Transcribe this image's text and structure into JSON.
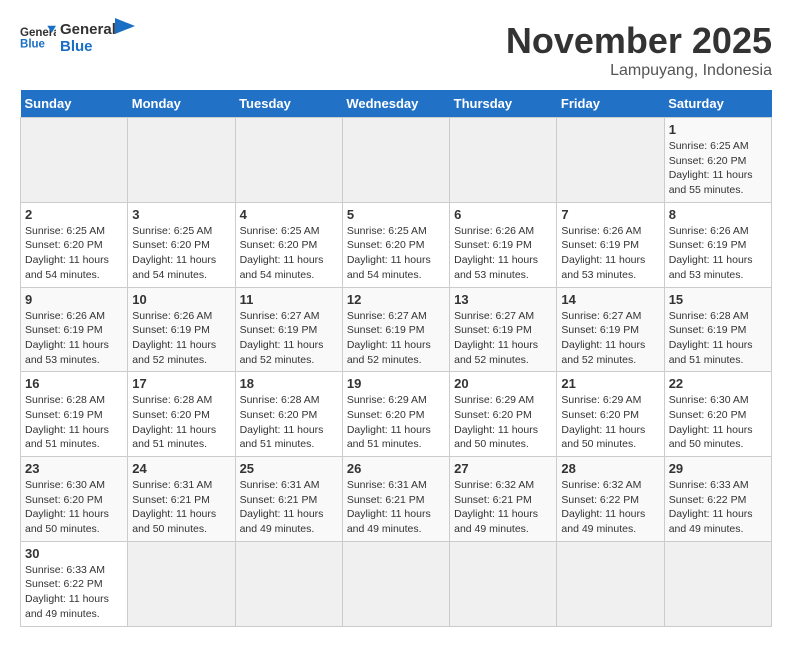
{
  "header": {
    "logo_general": "General",
    "logo_blue": "Blue",
    "month_title": "November 2025",
    "subtitle": "Lampuyang, Indonesia"
  },
  "days_of_week": [
    "Sunday",
    "Monday",
    "Tuesday",
    "Wednesday",
    "Thursday",
    "Friday",
    "Saturday"
  ],
  "weeks": [
    [
      {
        "day": "",
        "details": ""
      },
      {
        "day": "",
        "details": ""
      },
      {
        "day": "",
        "details": ""
      },
      {
        "day": "",
        "details": ""
      },
      {
        "day": "",
        "details": ""
      },
      {
        "day": "",
        "details": ""
      },
      {
        "day": "1",
        "details": "Sunrise: 6:25 AM\nSunset: 6:20 PM\nDaylight: 11 hours and 55 minutes."
      }
    ],
    [
      {
        "day": "2",
        "details": "Sunrise: 6:25 AM\nSunset: 6:20 PM\nDaylight: 11 hours and 54 minutes."
      },
      {
        "day": "3",
        "details": "Sunrise: 6:25 AM\nSunset: 6:20 PM\nDaylight: 11 hours and 54 minutes."
      },
      {
        "day": "4",
        "details": "Sunrise: 6:25 AM\nSunset: 6:20 PM\nDaylight: 11 hours and 54 minutes."
      },
      {
        "day": "5",
        "details": "Sunrise: 6:25 AM\nSunset: 6:20 PM\nDaylight: 11 hours and 54 minutes."
      },
      {
        "day": "6",
        "details": "Sunrise: 6:26 AM\nSunset: 6:19 PM\nDaylight: 11 hours and 53 minutes."
      },
      {
        "day": "7",
        "details": "Sunrise: 6:26 AM\nSunset: 6:19 PM\nDaylight: 11 hours and 53 minutes."
      },
      {
        "day": "8",
        "details": "Sunrise: 6:26 AM\nSunset: 6:19 PM\nDaylight: 11 hours and 53 minutes."
      }
    ],
    [
      {
        "day": "9",
        "details": "Sunrise: 6:26 AM\nSunset: 6:19 PM\nDaylight: 11 hours and 53 minutes."
      },
      {
        "day": "10",
        "details": "Sunrise: 6:26 AM\nSunset: 6:19 PM\nDaylight: 11 hours and 52 minutes."
      },
      {
        "day": "11",
        "details": "Sunrise: 6:27 AM\nSunset: 6:19 PM\nDaylight: 11 hours and 52 minutes."
      },
      {
        "day": "12",
        "details": "Sunrise: 6:27 AM\nSunset: 6:19 PM\nDaylight: 11 hours and 52 minutes."
      },
      {
        "day": "13",
        "details": "Sunrise: 6:27 AM\nSunset: 6:19 PM\nDaylight: 11 hours and 52 minutes."
      },
      {
        "day": "14",
        "details": "Sunrise: 6:27 AM\nSunset: 6:19 PM\nDaylight: 11 hours and 52 minutes."
      },
      {
        "day": "15",
        "details": "Sunrise: 6:28 AM\nSunset: 6:19 PM\nDaylight: 11 hours and 51 minutes."
      }
    ],
    [
      {
        "day": "16",
        "details": "Sunrise: 6:28 AM\nSunset: 6:19 PM\nDaylight: 11 hours and 51 minutes."
      },
      {
        "day": "17",
        "details": "Sunrise: 6:28 AM\nSunset: 6:20 PM\nDaylight: 11 hours and 51 minutes."
      },
      {
        "day": "18",
        "details": "Sunrise: 6:28 AM\nSunset: 6:20 PM\nDaylight: 11 hours and 51 minutes."
      },
      {
        "day": "19",
        "details": "Sunrise: 6:29 AM\nSunset: 6:20 PM\nDaylight: 11 hours and 51 minutes."
      },
      {
        "day": "20",
        "details": "Sunrise: 6:29 AM\nSunset: 6:20 PM\nDaylight: 11 hours and 50 minutes."
      },
      {
        "day": "21",
        "details": "Sunrise: 6:29 AM\nSunset: 6:20 PM\nDaylight: 11 hours and 50 minutes."
      },
      {
        "day": "22",
        "details": "Sunrise: 6:30 AM\nSunset: 6:20 PM\nDaylight: 11 hours and 50 minutes."
      }
    ],
    [
      {
        "day": "23",
        "details": "Sunrise: 6:30 AM\nSunset: 6:20 PM\nDaylight: 11 hours and 50 minutes."
      },
      {
        "day": "24",
        "details": "Sunrise: 6:31 AM\nSunset: 6:21 PM\nDaylight: 11 hours and 50 minutes."
      },
      {
        "day": "25",
        "details": "Sunrise: 6:31 AM\nSunset: 6:21 PM\nDaylight: 11 hours and 49 minutes."
      },
      {
        "day": "26",
        "details": "Sunrise: 6:31 AM\nSunset: 6:21 PM\nDaylight: 11 hours and 49 minutes."
      },
      {
        "day": "27",
        "details": "Sunrise: 6:32 AM\nSunset: 6:21 PM\nDaylight: 11 hours and 49 minutes."
      },
      {
        "day": "28",
        "details": "Sunrise: 6:32 AM\nSunset: 6:22 PM\nDaylight: 11 hours and 49 minutes."
      },
      {
        "day": "29",
        "details": "Sunrise: 6:33 AM\nSunset: 6:22 PM\nDaylight: 11 hours and 49 minutes."
      }
    ],
    [
      {
        "day": "30",
        "details": "Sunrise: 6:33 AM\nSunset: 6:22 PM\nDaylight: 11 hours and 49 minutes."
      },
      {
        "day": "",
        "details": ""
      },
      {
        "day": "",
        "details": ""
      },
      {
        "day": "",
        "details": ""
      },
      {
        "day": "",
        "details": ""
      },
      {
        "day": "",
        "details": ""
      },
      {
        "day": "",
        "details": ""
      }
    ]
  ]
}
